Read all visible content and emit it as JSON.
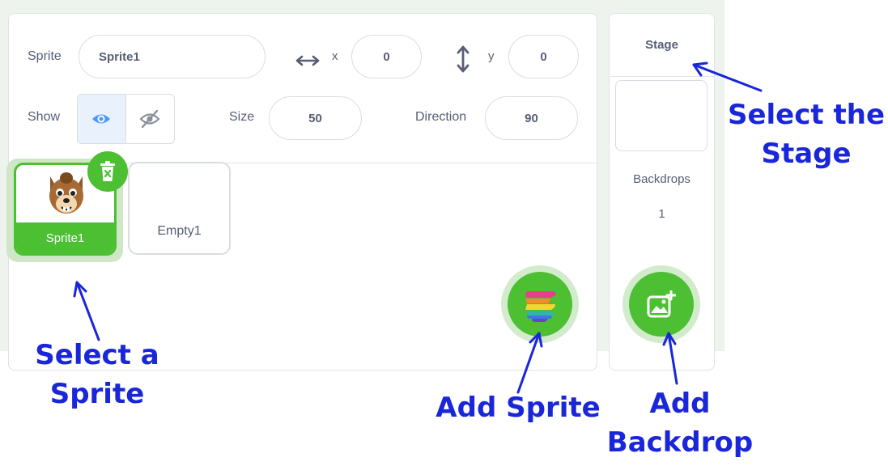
{
  "sprite_info": {
    "sprite_label": "Sprite",
    "sprite_name": "Sprite1",
    "x_label": "x",
    "x_value": "0",
    "y_label": "y",
    "y_value": "0",
    "show_label": "Show",
    "size_label": "Size",
    "size_value": "50",
    "direction_label": "Direction",
    "direction_value": "90"
  },
  "sprites": [
    {
      "name": "Sprite1",
      "selected": true
    },
    {
      "name": "Empty1",
      "selected": false
    }
  ],
  "stage": {
    "title": "Stage",
    "backdrops_label": "Backdrops",
    "backdrops_count": "1"
  },
  "annotations": {
    "select_stage": "Select the Stage",
    "select_sprite": "Select a Sprite",
    "add_sprite": "Add Sprite",
    "add_backdrop": "Add Backdrop"
  },
  "colors": {
    "accent_green": "#4cbf33",
    "annotation_blue": "#1a26d9",
    "eye_blue": "#4c97ff"
  },
  "icons": [
    "horizontal-arrows-icon",
    "vertical-arrows-icon",
    "eye-icon",
    "eye-slash-icon",
    "trash-icon",
    "character-icon",
    "sprite-logo-icon",
    "add-backdrop-icon"
  ]
}
